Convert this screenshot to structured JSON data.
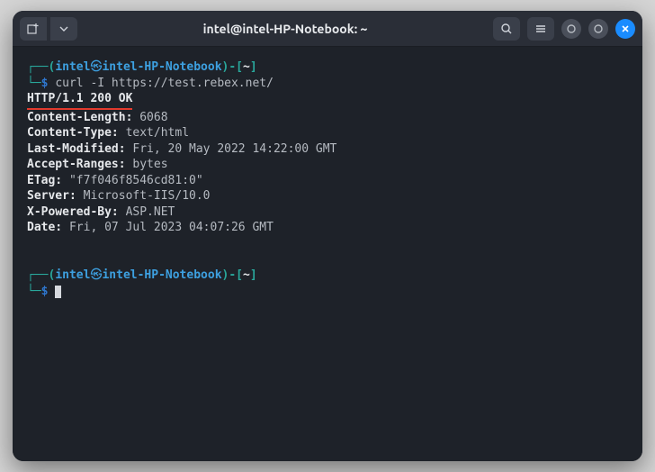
{
  "titlebar": {
    "title": "intel@intel-HP-Notebook: ~"
  },
  "prompt1": {
    "l": "┌──(",
    "user": "intel",
    "at": "㉿",
    "host": "intel-HP-Notebook",
    "r": ")-[",
    "path": "~",
    "close": "]",
    "l2": "└─",
    "dollar": "$",
    "cmd": "curl -I https://test.rebex.net/"
  },
  "status_line": "HTTP/1.1 200 OK",
  "headers": [
    {
      "k": "Content-Length:",
      "v": " 6068"
    },
    {
      "k": "Content-Type:",
      "v": " text/html"
    },
    {
      "k": "Last-Modified:",
      "v": " Fri, 20 May 2022 14:22:00 GMT"
    },
    {
      "k": "Accept-Ranges:",
      "v": " bytes"
    },
    {
      "k": "ETag:",
      "v": " \"f7f046f8546cd81:0\""
    },
    {
      "k": "Server:",
      "v": " Microsoft-IIS/10.0"
    },
    {
      "k": "X-Powered-By:",
      "v": " ASP.NET"
    },
    {
      "k": "Date:",
      "v": " Fri, 07 Jul 2023 04:07:26 GMT"
    }
  ],
  "prompt2": {
    "l": "┌──(",
    "user": "intel",
    "at": "㉿",
    "host": "intel-HP-Notebook",
    "r": ")-[",
    "path": "~",
    "close": "]",
    "l2": "└─",
    "dollar": "$"
  }
}
